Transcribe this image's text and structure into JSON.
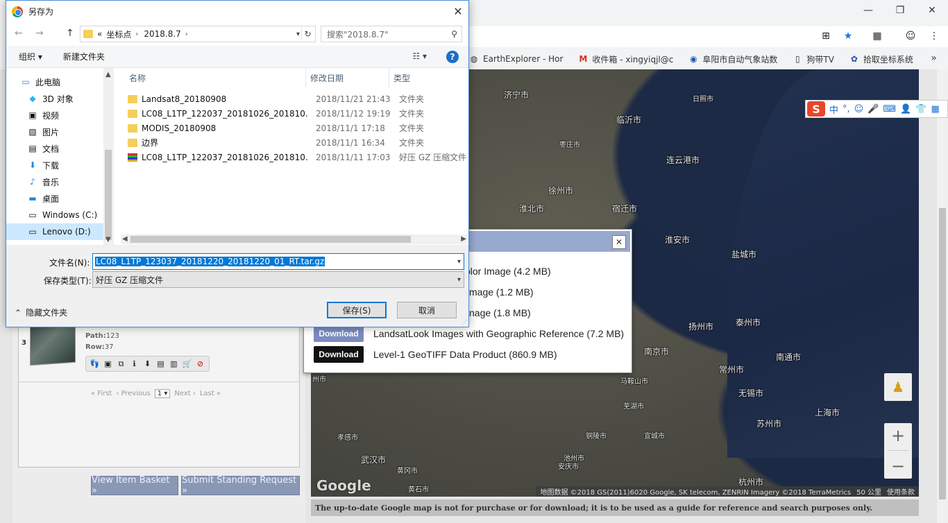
{
  "browser": {
    "window_controls": {
      "minimize": "—",
      "restore": "❐",
      "close": "✕"
    },
    "bookmarks": [
      {
        "label": "EarthExplorer - Hor",
        "icon": "globe-icon"
      },
      {
        "label": "收件箱 - xingyiqjl@c",
        "icon": "gmail-icon"
      },
      {
        "label": "阜阳市自动气象站数",
        "icon": "weather-icon"
      },
      {
        "label": "狗带TV",
        "icon": "page-icon"
      },
      {
        "label": "拾取坐标系统",
        "icon": "paw-icon"
      }
    ],
    "bookmarks_more": "»"
  },
  "dialog": {
    "title": "另存为",
    "close": "✕",
    "nav": {
      "back": "←",
      "forward": "→",
      "up": "↑"
    },
    "address": {
      "prefix": "«",
      "crumbs": [
        "坐标点",
        "2018.8.7"
      ]
    },
    "search_placeholder": "搜索\"2018.8.7\"",
    "toolbar": {
      "organize": "组织 ▾",
      "new_folder": "新建文件夹",
      "help": "?"
    },
    "nav_pane": [
      {
        "label": "此电脑",
        "icon": "computer-icon",
        "selected": false
      },
      {
        "label": "3D 对象",
        "icon": "cube-icon",
        "selected": false
      },
      {
        "label": "视频",
        "icon": "video-icon",
        "selected": false
      },
      {
        "label": "图片",
        "icon": "picture-icon",
        "selected": false
      },
      {
        "label": "文档",
        "icon": "document-icon",
        "selected": false
      },
      {
        "label": "下载",
        "icon": "download-icon",
        "selected": false
      },
      {
        "label": "音乐",
        "icon": "music-icon",
        "selected": false
      },
      {
        "label": "桌面",
        "icon": "desktop-icon",
        "selected": false
      },
      {
        "label": "Windows (C:)",
        "icon": "drive-icon",
        "selected": false
      },
      {
        "label": "Lenovo (D:)",
        "icon": "drive-icon",
        "selected": true
      }
    ],
    "columns": {
      "name": "名称",
      "date": "修改日期",
      "type": "类型"
    },
    "files": [
      {
        "name": "Landsat8_20180908",
        "date": "2018/11/21 21:43",
        "type": "文件夹",
        "kind": "folder"
      },
      {
        "name": "LC08_L1TP_122037_20181026_201810...",
        "date": "2018/11/12 19:19",
        "type": "文件夹",
        "kind": "folder"
      },
      {
        "name": "MODIS_20180908",
        "date": "2018/11/1 17:18",
        "type": "文件夹",
        "kind": "folder"
      },
      {
        "name": "边界",
        "date": "2018/11/1 16:34",
        "type": "文件夹",
        "kind": "folder"
      },
      {
        "name": "LC08_L1TP_122037_20181026_201810...",
        "date": "2018/11/11 17:03",
        "type": "好压 GZ 压缩文件",
        "kind": "archive"
      }
    ],
    "filename_label": "文件名(N):",
    "filename_value": "LC08_L1TP_123037_20181220_20181220_01_RT.tar.gz",
    "filetype_label": "保存类型(T):",
    "filetype_value": "好压 GZ 压缩文件",
    "hide_folders": "隐藏文件夹",
    "save_button": "保存(S)",
    "cancel_button": "取消"
  },
  "download_popup": {
    "close": "✕",
    "rows": [
      {
        "button": "",
        "text": "olor Image (4.2 MB)"
      },
      {
        "button": "",
        "text": "mage (1.2 MB)"
      },
      {
        "button": "",
        "text": "nage (1.8 MB)"
      },
      {
        "button": "Download",
        "text": "LandsatLook Images with Geographic Reference (7.2 MB)",
        "style": "light"
      },
      {
        "button": "Download",
        "text": "Level-1 GeoTIFF Data Product (860.9 MB)",
        "style": "dark"
      }
    ]
  },
  "results": {
    "row_number": "3",
    "path_label": "Path:",
    "path_value": "123",
    "row_label": "Row:",
    "row_value": "37",
    "pager": {
      "first": "« First",
      "previous": "‹ Previous",
      "page": "1 ▾",
      "next": "Next ›",
      "last": "Last »"
    },
    "view_basket": "View Item Basket »",
    "standing_request": "Submit Standing Request »"
  },
  "map": {
    "cities": [
      "济宁市",
      "日照市",
      "临沂市",
      "枣庄市",
      "连云港市",
      "徐州市",
      "宿迁市",
      "淮北市",
      "淮安市",
      "盐城市",
      "扬州市",
      "泰州市",
      "南京市",
      "常州市",
      "南通市",
      "马鞍山市",
      "无锡市",
      "芜湖市",
      "苏州市",
      "上海市",
      "孝感市",
      "武汉市",
      "黄冈市",
      "铜陵市",
      "池州市",
      "安庆市",
      "宣城市",
      "杭州市",
      "黄石市",
      "州市"
    ],
    "google": "Google",
    "attribution": "地图数据 ©2018 GS(2011)6020 Google, SK telecom, ZENRIN Imagery ©2018 TerraMetrics",
    "scale": "50 公里",
    "terms": "使用条款",
    "zoom_in": "+",
    "zoom_out": "−",
    "footer_note": "The up-to-date Google map is not for purchase or for download; it is to be used as a guide for reference and search purposes only."
  },
  "ime": {
    "logo": "S",
    "lang": "中",
    "punct": "°,"
  }
}
